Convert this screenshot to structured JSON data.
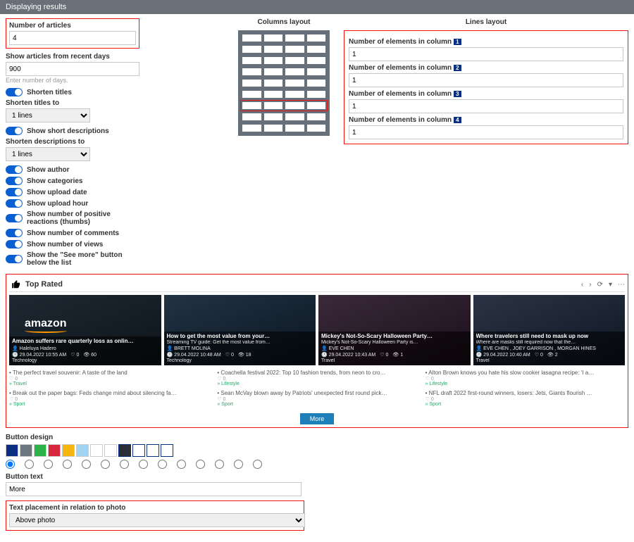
{
  "header": {
    "title": "Displaying results"
  },
  "left": {
    "num_articles": {
      "label": "Number of articles",
      "value": "4"
    },
    "recent_days": {
      "label": "Show articles from recent days",
      "value": "900",
      "hint": "Enter number of days."
    },
    "shorten_titles": {
      "label": "Shorten titles"
    },
    "shorten_titles_to": {
      "label": "Shorten titles to",
      "value": "1 lines"
    },
    "short_desc": {
      "label": "Show short descriptions"
    },
    "shorten_desc_to": {
      "label": "Shorten descriptions to",
      "value": "1 lines"
    },
    "toggles": [
      "Show author",
      "Show categories",
      "Show upload date",
      "Show upload hour",
      "Show number of positive reactions (thumbs)",
      "Show number of comments",
      "Show number of views",
      "Show the \"See more\" button below the list"
    ],
    "button_design": {
      "label": "Button design"
    },
    "button_text": {
      "label": "Button text",
      "value": "More"
    },
    "text_placement": {
      "label": "Text placement in relation to photo",
      "value": "Above photo"
    }
  },
  "mid": {
    "title": "Columns layout"
  },
  "right": {
    "title": "Lines layout",
    "fields": [
      {
        "label": "Number of elements in column",
        "n": "1",
        "value": "1"
      },
      {
        "label": "Number of elements in column",
        "n": "2",
        "value": "1"
      },
      {
        "label": "Number of elements in column",
        "n": "3",
        "value": "1"
      },
      {
        "label": "Number of elements in column",
        "n": "4",
        "value": "1"
      }
    ]
  },
  "swatches": [
    "#0a2f82",
    "#6e7680",
    "#2fb14a",
    "#d7263d",
    "#f5b70f",
    "#9fd3f0",
    "#ffffff",
    "#ffffff",
    "#2a2f37",
    "#ffffff",
    "#ffffff",
    "#ffffff"
  ],
  "preview": {
    "title": "Top Rated",
    "cards": [
      {
        "title": "Amazon suffers rare quarterly loss as onlin…",
        "sub": "",
        "author": "Haleluya Hadero",
        "date": "29.04.2022 10:55 AM",
        "thumbs": "0",
        "views": "60",
        "cat": "Technology",
        "logo": "amazon"
      },
      {
        "title": "How to get the most value from your…",
        "sub": "Streaming TV guide: Get the most value from…",
        "author": "BRETT MOLINA",
        "date": "29.04.2022 10:48 AM",
        "thumbs": "0",
        "views": "18",
        "cat": "Technology"
      },
      {
        "title": "Mickey's Not-So-Scary Halloween Party…",
        "sub": "Mickey's Not-So-Scary Halloween Party is…",
        "author": "EVE CHEN",
        "date": "29.04.2022 10:43 AM",
        "thumbs": "0",
        "views": "1",
        "cat": "Travel"
      },
      {
        "title": "Where travelers still need to mask up now",
        "sub": "Where are masks still required now that the…",
        "author": "EVE CHEN , JOEY GARRISON , MORGAN HINES",
        "date": "29.04.2022 10:40 AM",
        "thumbs": "0",
        "views": "2",
        "cat": "Travel"
      }
    ],
    "list": [
      {
        "title": "The perfect travel souvenir: A taste of the land",
        "meta": "♡ 0",
        "cat": "» Travel"
      },
      {
        "title": "Break out the paper bags: Feds change mind about silencing fa…",
        "meta": "♡ 0",
        "cat": "» Sport"
      },
      {
        "title": "Coachella festival 2022: Top 10 fashion trends, from neon to cro…",
        "meta": "♡ 0",
        "cat": "» Lifestyle"
      },
      {
        "title": "Sean McVay blown away by Patriots' unexpected first round pick…",
        "meta": "♡ 0",
        "cat": "» Sport"
      },
      {
        "title": "Alton Brown knows you hate his slow cooker lasagna recipe: 'I a…",
        "meta": "♡ 0",
        "cat": "» Lifestyle"
      },
      {
        "title": "NFL draft 2022 first-round winners, losers: Jets, Giants flourish …",
        "meta": "♡ 0",
        "cat": "» Sport"
      }
    ],
    "more": "More"
  }
}
